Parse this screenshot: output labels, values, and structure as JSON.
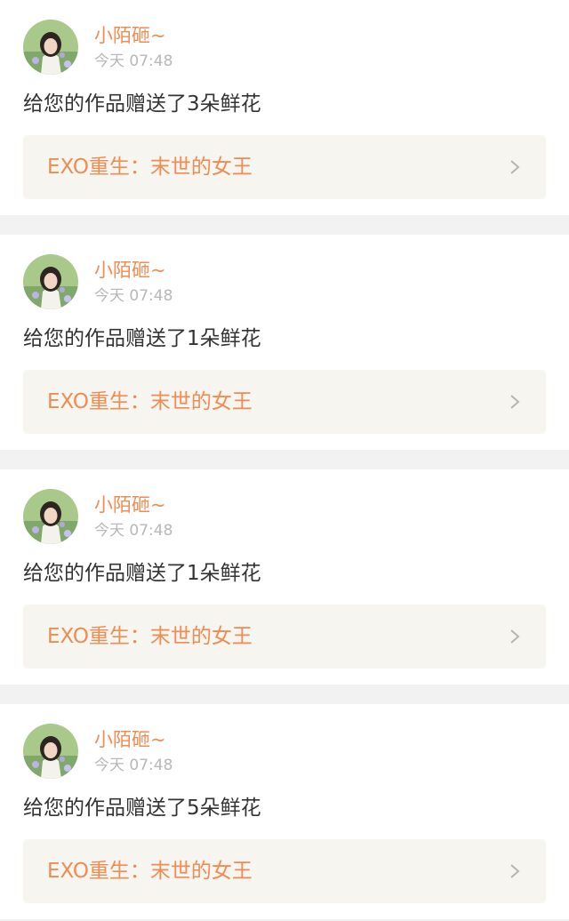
{
  "notifications": [
    {
      "username": "小陌砸~",
      "time": "今天 07:48",
      "message": "给您的作品赠送了3朵鲜花",
      "work_title": "EXO重生：末世的女王",
      "avatar_icon": "user-avatar-photo",
      "chevron_icon": "chevron-right-icon"
    },
    {
      "username": "小陌砸~",
      "time": "今天 07:48",
      "message": "给您的作品赠送了1朵鲜花",
      "work_title": "EXO重生：末世的女王",
      "avatar_icon": "user-avatar-photo",
      "chevron_icon": "chevron-right-icon"
    },
    {
      "username": "小陌砸~",
      "time": "今天 07:48",
      "message": "给您的作品赠送了1朵鲜花",
      "work_title": "EXO重生：末世的女王",
      "avatar_icon": "user-avatar-photo",
      "chevron_icon": "chevron-right-icon"
    },
    {
      "username": "小陌砸~",
      "time": "今天 07:48",
      "message": "给您的作品赠送了5朵鲜花",
      "work_title": "EXO重生：末世的女王",
      "avatar_icon": "user-avatar-photo",
      "chevron_icon": "chevron-right-icon"
    }
  ],
  "colors": {
    "accent": "#f08b52",
    "text_primary": "#333333",
    "text_secondary": "#b8b8b8",
    "link_background": "#f6f5ef",
    "page_background": "#f2f2f2",
    "card_background": "#ffffff"
  }
}
